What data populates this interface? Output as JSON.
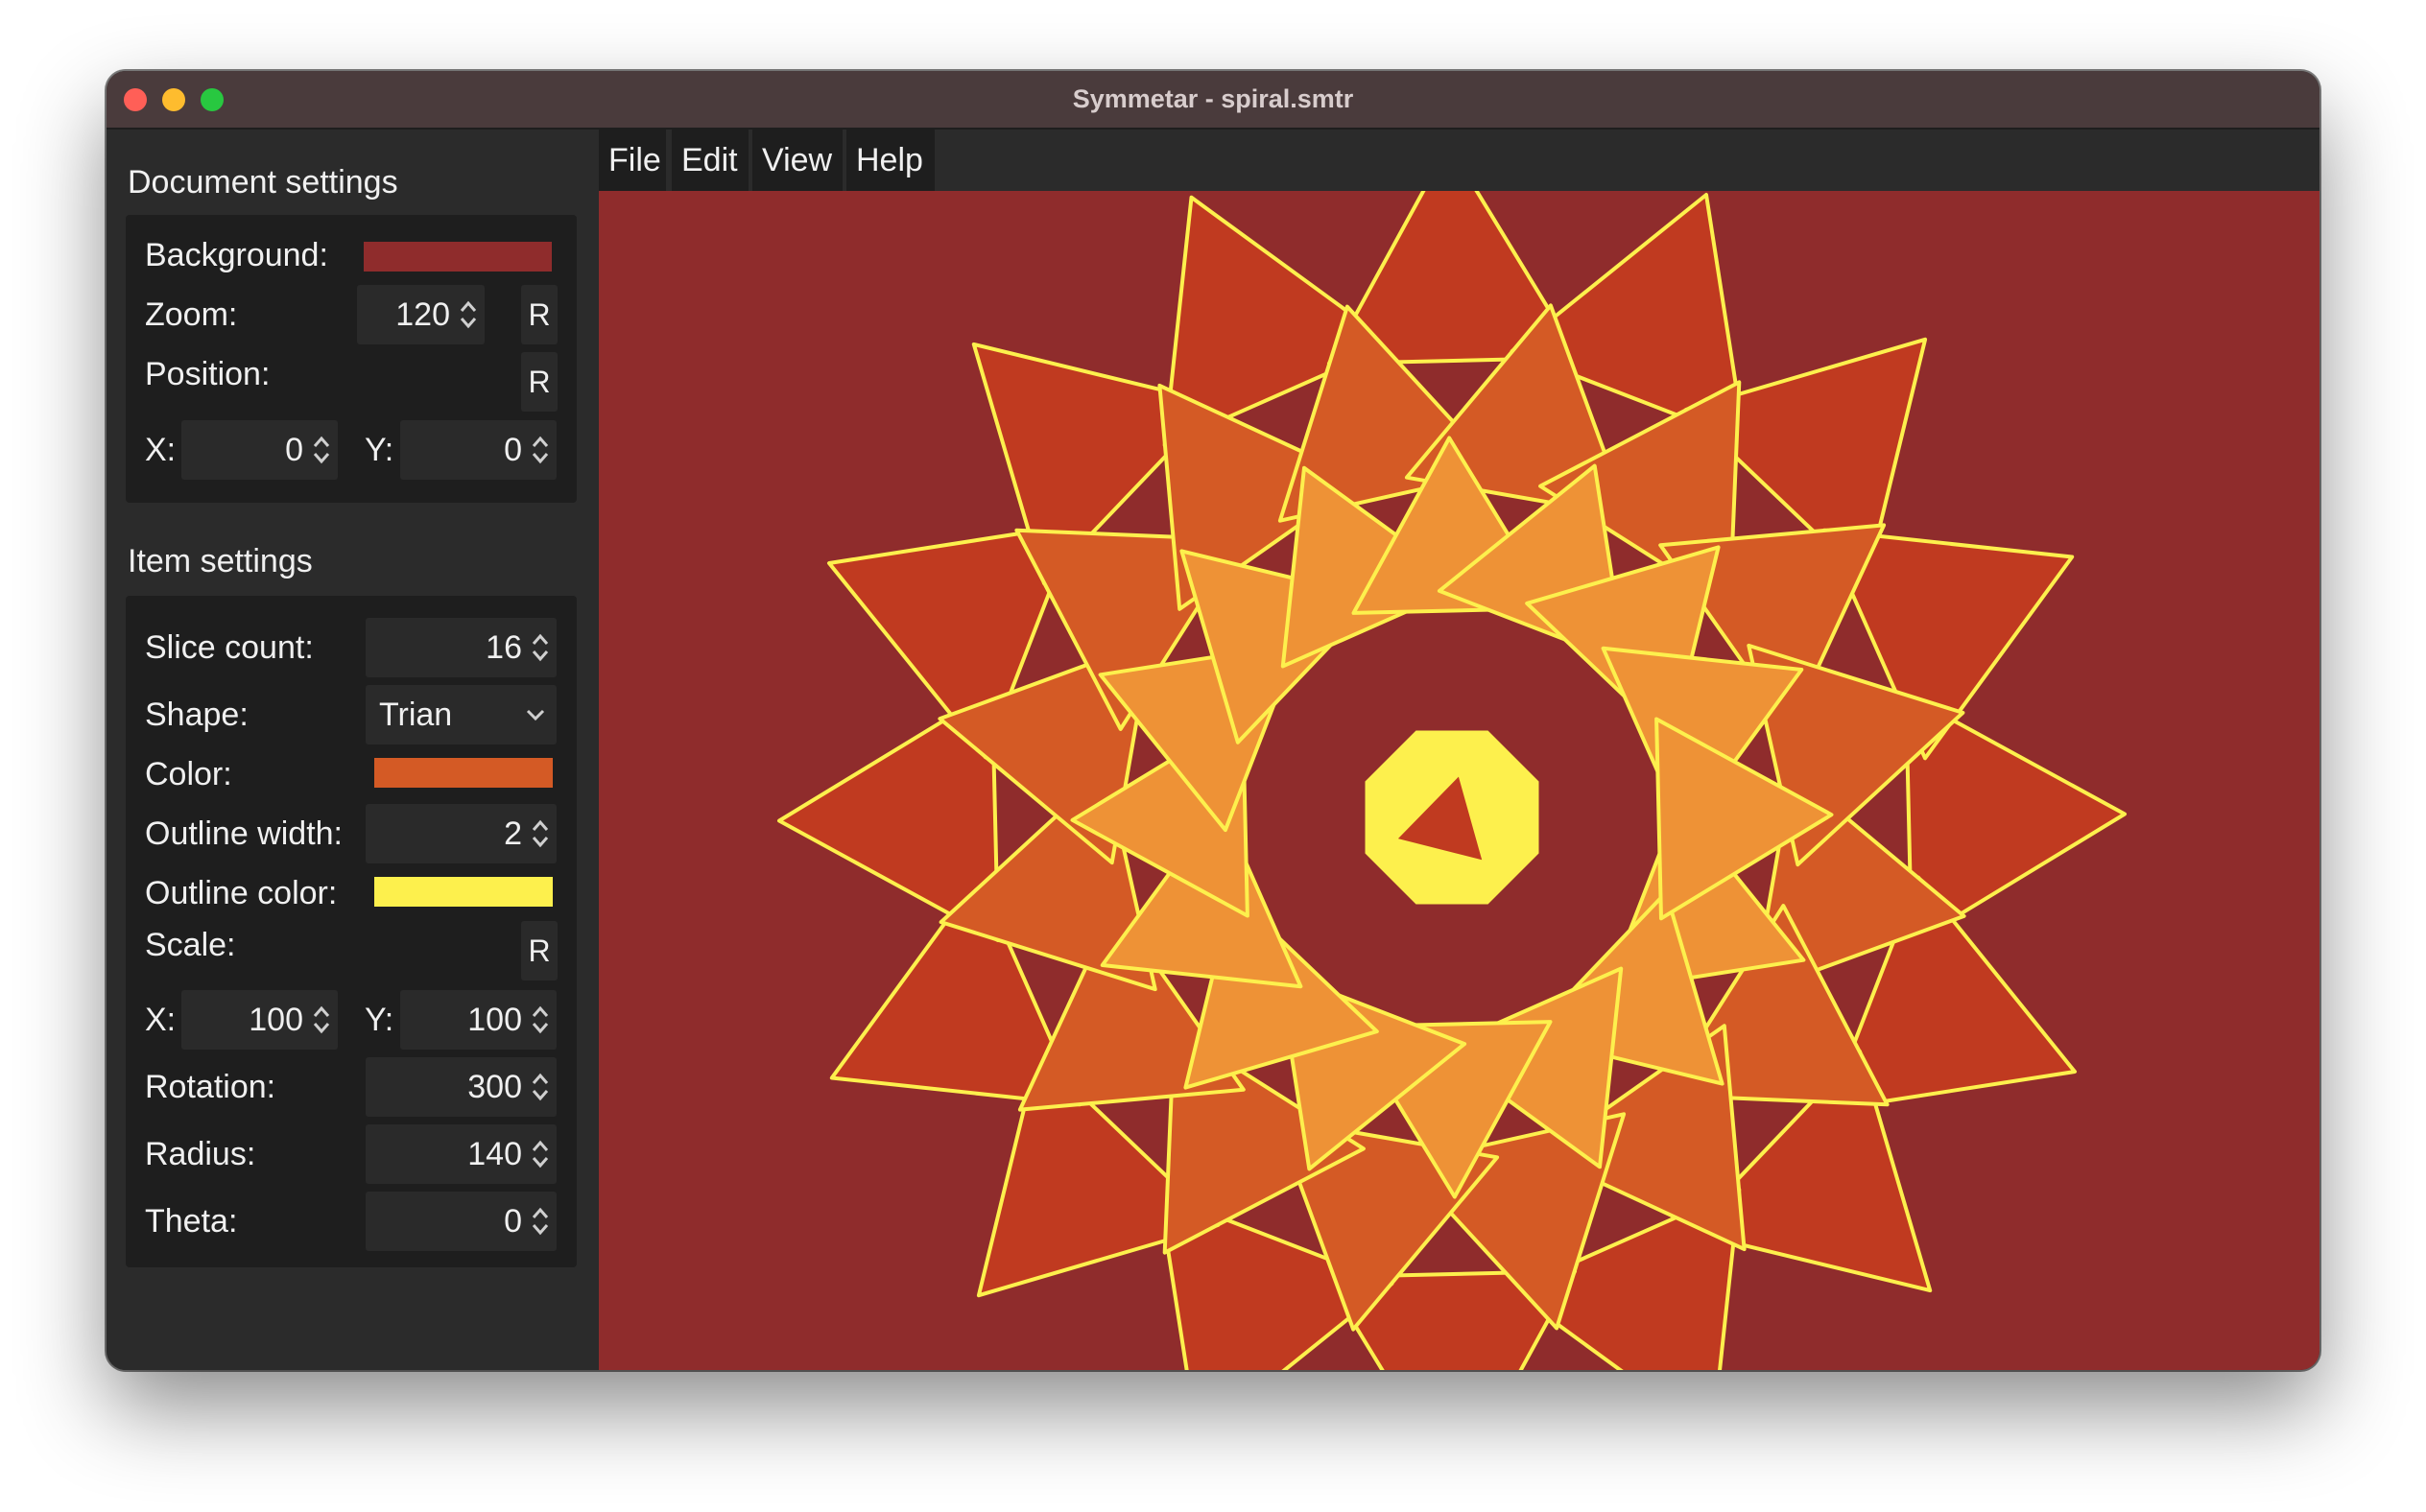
{
  "window": {
    "title": "Symmetar - spiral.smtr"
  },
  "document_settings": {
    "title": "Document settings",
    "background_label": "Background:",
    "background_color": "#8f2c2c",
    "zoom_label": "Zoom:",
    "zoom_value": "120",
    "reset_label": "R",
    "position_label": "Position:",
    "x_label": "X:",
    "x_value": "0",
    "y_label": "Y:",
    "y_value": "0"
  },
  "item_settings": {
    "title": "Item settings",
    "slice_count_label": "Slice count:",
    "slice_count_value": "16",
    "shape_label": "Shape:",
    "shape_value": "Trian",
    "color_label": "Color:",
    "color_value": "#d45a25",
    "outline_width_label": "Outline width:",
    "outline_width_value": "2",
    "outline_color_label": "Outline color:",
    "outline_color_value": "#fdf04d",
    "scale_label": "Scale:",
    "reset_label": "R",
    "x_label": "X:",
    "x_value": "100",
    "y_label": "Y:",
    "y_value": "100",
    "rotation_label": "Rotation:",
    "rotation_value": "300",
    "radius_label": "Radius:",
    "radius_value": "140",
    "theta_label": "Theta:",
    "theta_value": "0"
  },
  "menu": {
    "file": "File",
    "edit": "Edit",
    "view": "View",
    "help": "Help"
  },
  "artwork": {
    "slice_count": 16,
    "shape": "triangle",
    "fill_colors": [
      "#c03a20",
      "#d45a25",
      "#ee9236"
    ],
    "outline_color": "#fdf04d",
    "center_fill": "#fdf04d",
    "center_triangle": "#c03a20"
  }
}
